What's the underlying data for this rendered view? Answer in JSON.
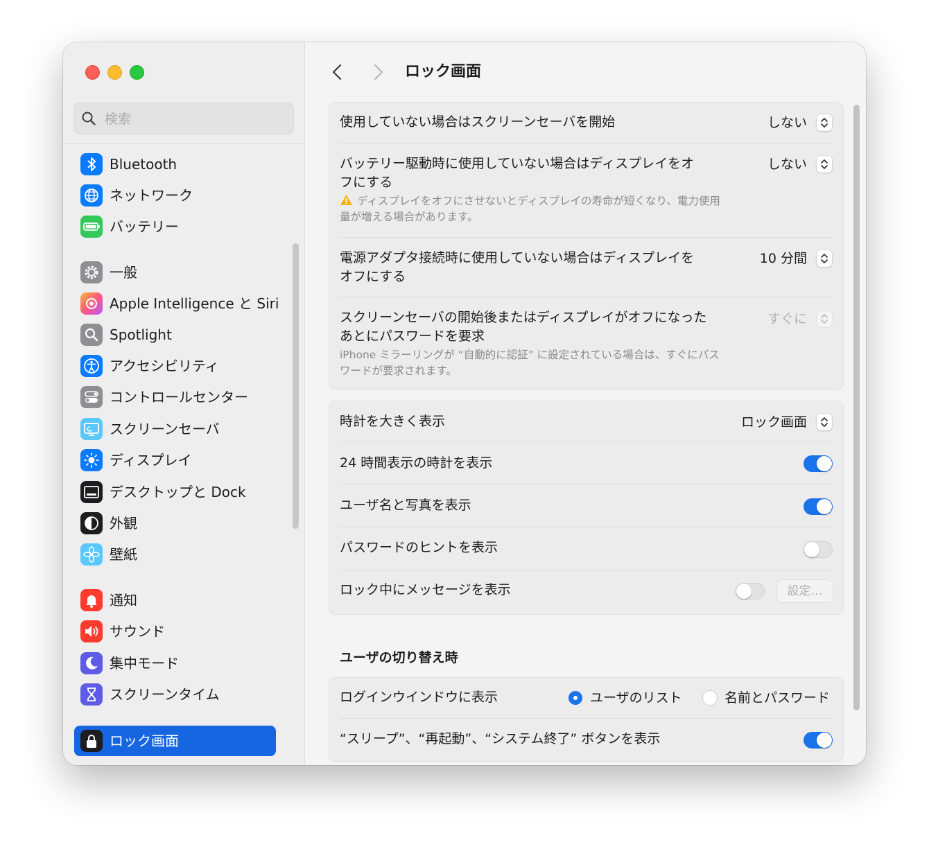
{
  "sidebar": {
    "search_placeholder": "検索",
    "items": [
      {
        "label": "Bluetooth",
        "icon": "bluetooth-icon",
        "color": "#0a7aff"
      },
      {
        "label": "ネットワーク",
        "icon": "globe-icon",
        "color": "#0a7aff"
      },
      {
        "label": "バッテリー",
        "icon": "battery-icon",
        "color": "#34c759"
      },
      {
        "label": "一般",
        "icon": "gear-icon",
        "color": "#8e8e93"
      },
      {
        "label": "Apple Intelligence と Siri",
        "icon": "apple-intelligence-icon",
        "color": "#ff6b5a"
      },
      {
        "label": "Spotlight",
        "icon": "magnifier-icon",
        "color": "#8e8e93"
      },
      {
        "label": "アクセシビリティ",
        "icon": "accessibility-icon",
        "color": "#0a7aff"
      },
      {
        "label": "コントロールセンター",
        "icon": "control-center-icon",
        "color": "#8e8e93"
      },
      {
        "label": "スクリーンセーバ",
        "icon": "screensaver-icon",
        "color": "#5ac8fa"
      },
      {
        "label": "ディスプレイ",
        "icon": "sun-icon",
        "color": "#0a7aff"
      },
      {
        "label": "デスクトップと Dock",
        "icon": "dock-icon",
        "color": "#1d1d1f"
      },
      {
        "label": "外観",
        "icon": "appearance-icon",
        "color": "#1d1d1f"
      },
      {
        "label": "壁紙",
        "icon": "flower-icon",
        "color": "#5ac8fa"
      },
      {
        "label": "通知",
        "icon": "bell-icon",
        "color": "#ff3b30"
      },
      {
        "label": "サウンド",
        "icon": "speaker-icon",
        "color": "#ff3b30"
      },
      {
        "label": "集中モード",
        "icon": "moon-icon",
        "color": "#5e5ce6"
      },
      {
        "label": "スクリーンタイム",
        "icon": "hourglass-icon",
        "color": "#5e5ce6"
      },
      {
        "label": "ロック画面",
        "icon": "lock-icon",
        "color": "#1d1d1f",
        "active": true
      }
    ]
  },
  "main": {
    "title": "ロック画面",
    "group1": {
      "screensaver_label": "使用していない場合はスクリーンセーバを開始",
      "screensaver_value": "しない",
      "battery_label": "バッテリー駆動時に使用していない場合はディスプレイをオフにする",
      "battery_value": "しない",
      "battery_warning": "ディスプレイをオフにさせないとディスプレイの寿命が短くなり、電力使用量が増える場合があります。",
      "adapter_label": "電源アダプタ接続時に使用していない場合はディスプレイをオフにする",
      "adapter_value": "10 分間",
      "password_label": "スクリーンセーバの開始後またはディスプレイがオフになったあとにパスワードを要求",
      "password_value": "すぐに",
      "password_note": "iPhone ミラーリングが “自動的に認証” に設定されている場合は、すぐにパスワードが要求されます。"
    },
    "group2": {
      "clock_label": "時計を大きく表示",
      "clock_value": "ロック画面",
      "clock24_label": "24 時間表示の時計を表示",
      "clock24_on": true,
      "username_label": "ユーザ名と写真を表示",
      "username_on": true,
      "hint_label": "パスワードのヒントを表示",
      "hint_on": false,
      "message_label": "ロック中にメッセージを表示",
      "message_on": false,
      "settings_button": "設定…"
    },
    "switch_section": {
      "title": "ユーザの切り替え時",
      "login_label": "ログインウインドウに表示",
      "option_list": "ユーザのリスト",
      "option_name": "名前とパスワード",
      "selected": "ユーザのリスト",
      "buttons_label": "“スリープ”、“再起動”、“システム終了” ボタンを表示",
      "buttons_on": true
    }
  }
}
